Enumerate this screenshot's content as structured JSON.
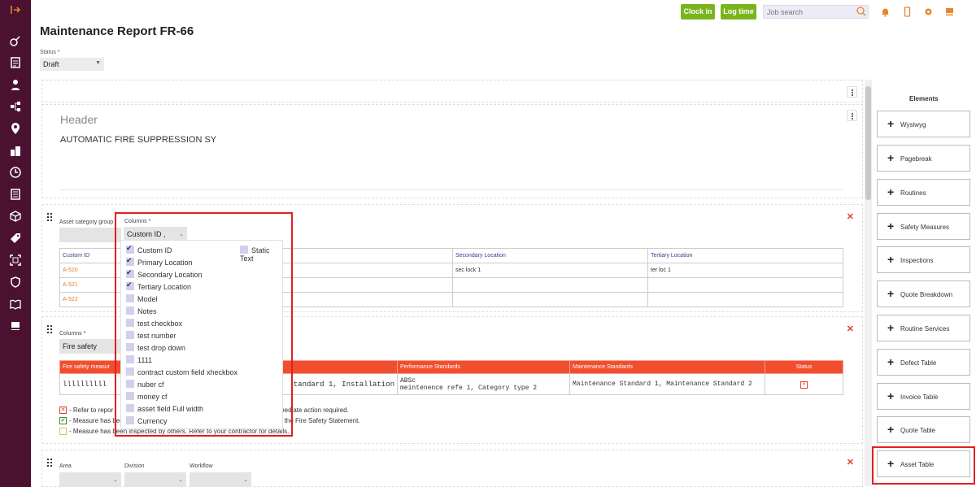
{
  "topbar": {
    "clock_in": "Clock in",
    "log_time": "Log time",
    "search_placeholder": "Job search",
    "accent": "#7ab51d",
    "icon_color": "#e8872a"
  },
  "sidebar": {
    "color": "#4a1230",
    "icons": [
      "sign-out-icon",
      "tag-icon",
      "checklist-icon",
      "user-icon",
      "network-icon",
      "location-pin-icon",
      "buildings-icon",
      "clock-icon",
      "report-icon",
      "box-icon",
      "price-tag-icon",
      "scan-icon",
      "shield-icon",
      "book-icon",
      "bookmark-icon"
    ]
  },
  "page": {
    "title": "Maintenance Report FR-66",
    "status_label": "Status *",
    "status_value": "Draft"
  },
  "header_section": {
    "heading": "Header",
    "text": "AUTOMATIC FIRE SUPPRESSION SY"
  },
  "asset_section": {
    "group_label": "Asset category group",
    "columns_label": "Columns *",
    "columns_value": "Custom ID ,",
    "table": {
      "headers": [
        "Custom ID",
        "Location",
        "Secondary Location",
        "Tertiary Location"
      ],
      "rows": [
        [
          "A-520",
          "",
          "sec lock 1",
          "ter loc 1"
        ],
        [
          "A-521",
          "",
          "",
          ""
        ],
        [
          "A-522",
          "",
          "",
          ""
        ]
      ]
    }
  },
  "columns_dropdown": {
    "options": [
      {
        "label": "Custom ID",
        "checked": true
      },
      {
        "label": "Primary Location",
        "checked": true
      },
      {
        "label": "Secondary Location",
        "checked": true
      },
      {
        "label": "Tertiary Location",
        "checked": true
      },
      {
        "label": "Model",
        "checked": false
      },
      {
        "label": "Notes",
        "checked": false
      },
      {
        "label": "test checkbox",
        "checked": false
      },
      {
        "label": "test number",
        "checked": false
      },
      {
        "label": "test drop down",
        "checked": false
      },
      {
        "label": "1111",
        "checked": false
      },
      {
        "label": "contract custom field xheckbox",
        "checked": false
      },
      {
        "label": "nuber cf",
        "checked": false
      },
      {
        "label": "money cf",
        "checked": false
      },
      {
        "label": "asset field Full width",
        "checked": false
      },
      {
        "label": "Currency",
        "checked": false
      }
    ],
    "static_text": "Static Text"
  },
  "fire_section": {
    "columns_label": "Columns *",
    "columns_value": "Fire safety",
    "table": {
      "headers": [
        "Fire safety measur",
        "",
        "Performance Standards",
        "Maintenance Standards",
        "Status"
      ],
      "row": [
        "llllllllll",
        "tandard 1, Installation",
        "ABSc\nmeintenence refe 1, Category type 2",
        "Maintenance Standard 1, Maintenance Standard 2",
        ""
      ]
    },
    "legend": [
      {
        "text": "- Refer to repor",
        "tail": "mediate action required."
      },
      {
        "text": "- Measure has bee",
        "tail": "n the Fire Safety Statement."
      },
      {
        "text": "- Measure has been inspected by others. Refer to your contractor for details.",
        "tail": ""
      }
    ]
  },
  "filter_section": {
    "area_label": "Area",
    "division_label": "Division",
    "workflow_label": "Workflow"
  },
  "elements": {
    "title": "Elements",
    "items": [
      "Wysiwyg",
      "Pagebreak",
      "Routines",
      "Safety Measures",
      "Inspections",
      "Quote Breakdown",
      "Routine Services",
      "Defect Table",
      "Invoice Table",
      "Quote Table",
      "Asset Table"
    ]
  }
}
